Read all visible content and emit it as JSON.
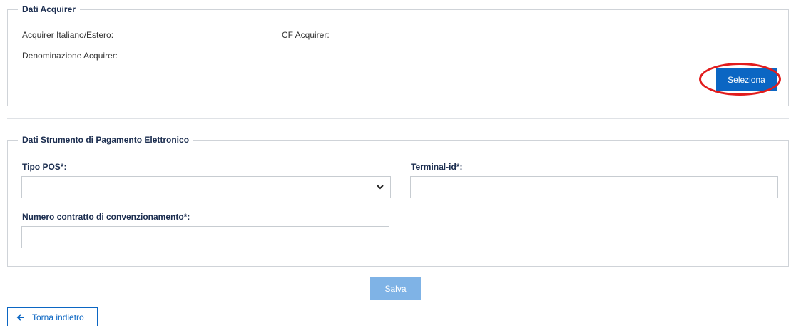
{
  "acquirer": {
    "legend": "Dati Acquirer",
    "italiano_estero_label": "Acquirer Italiano/Estero:",
    "cf_label": "CF Acquirer:",
    "denominazione_label": "Denominazione Acquirer:",
    "seleziona_label": "Seleziona"
  },
  "strumento": {
    "legend": "Dati Strumento di Pagamento Elettronico",
    "tipo_pos_label": "Tipo POS*:",
    "tipo_pos_value": "",
    "terminal_id_label": "Terminal-id*:",
    "terminal_id_value": "",
    "numero_contratto_label": "Numero contratto di convenzionamento*:",
    "numero_contratto_value": ""
  },
  "actions": {
    "salva_label": "Salva",
    "torna_indietro_label": "Torna indietro"
  },
  "icons": {
    "chevron": "chevron-down-icon",
    "back": "arrow-left-icon"
  },
  "colors": {
    "primary": "#0b66c3",
    "disabled": "#7fb3e6",
    "highlight": "#e21c1c",
    "legend_text": "#1b2d4f"
  }
}
